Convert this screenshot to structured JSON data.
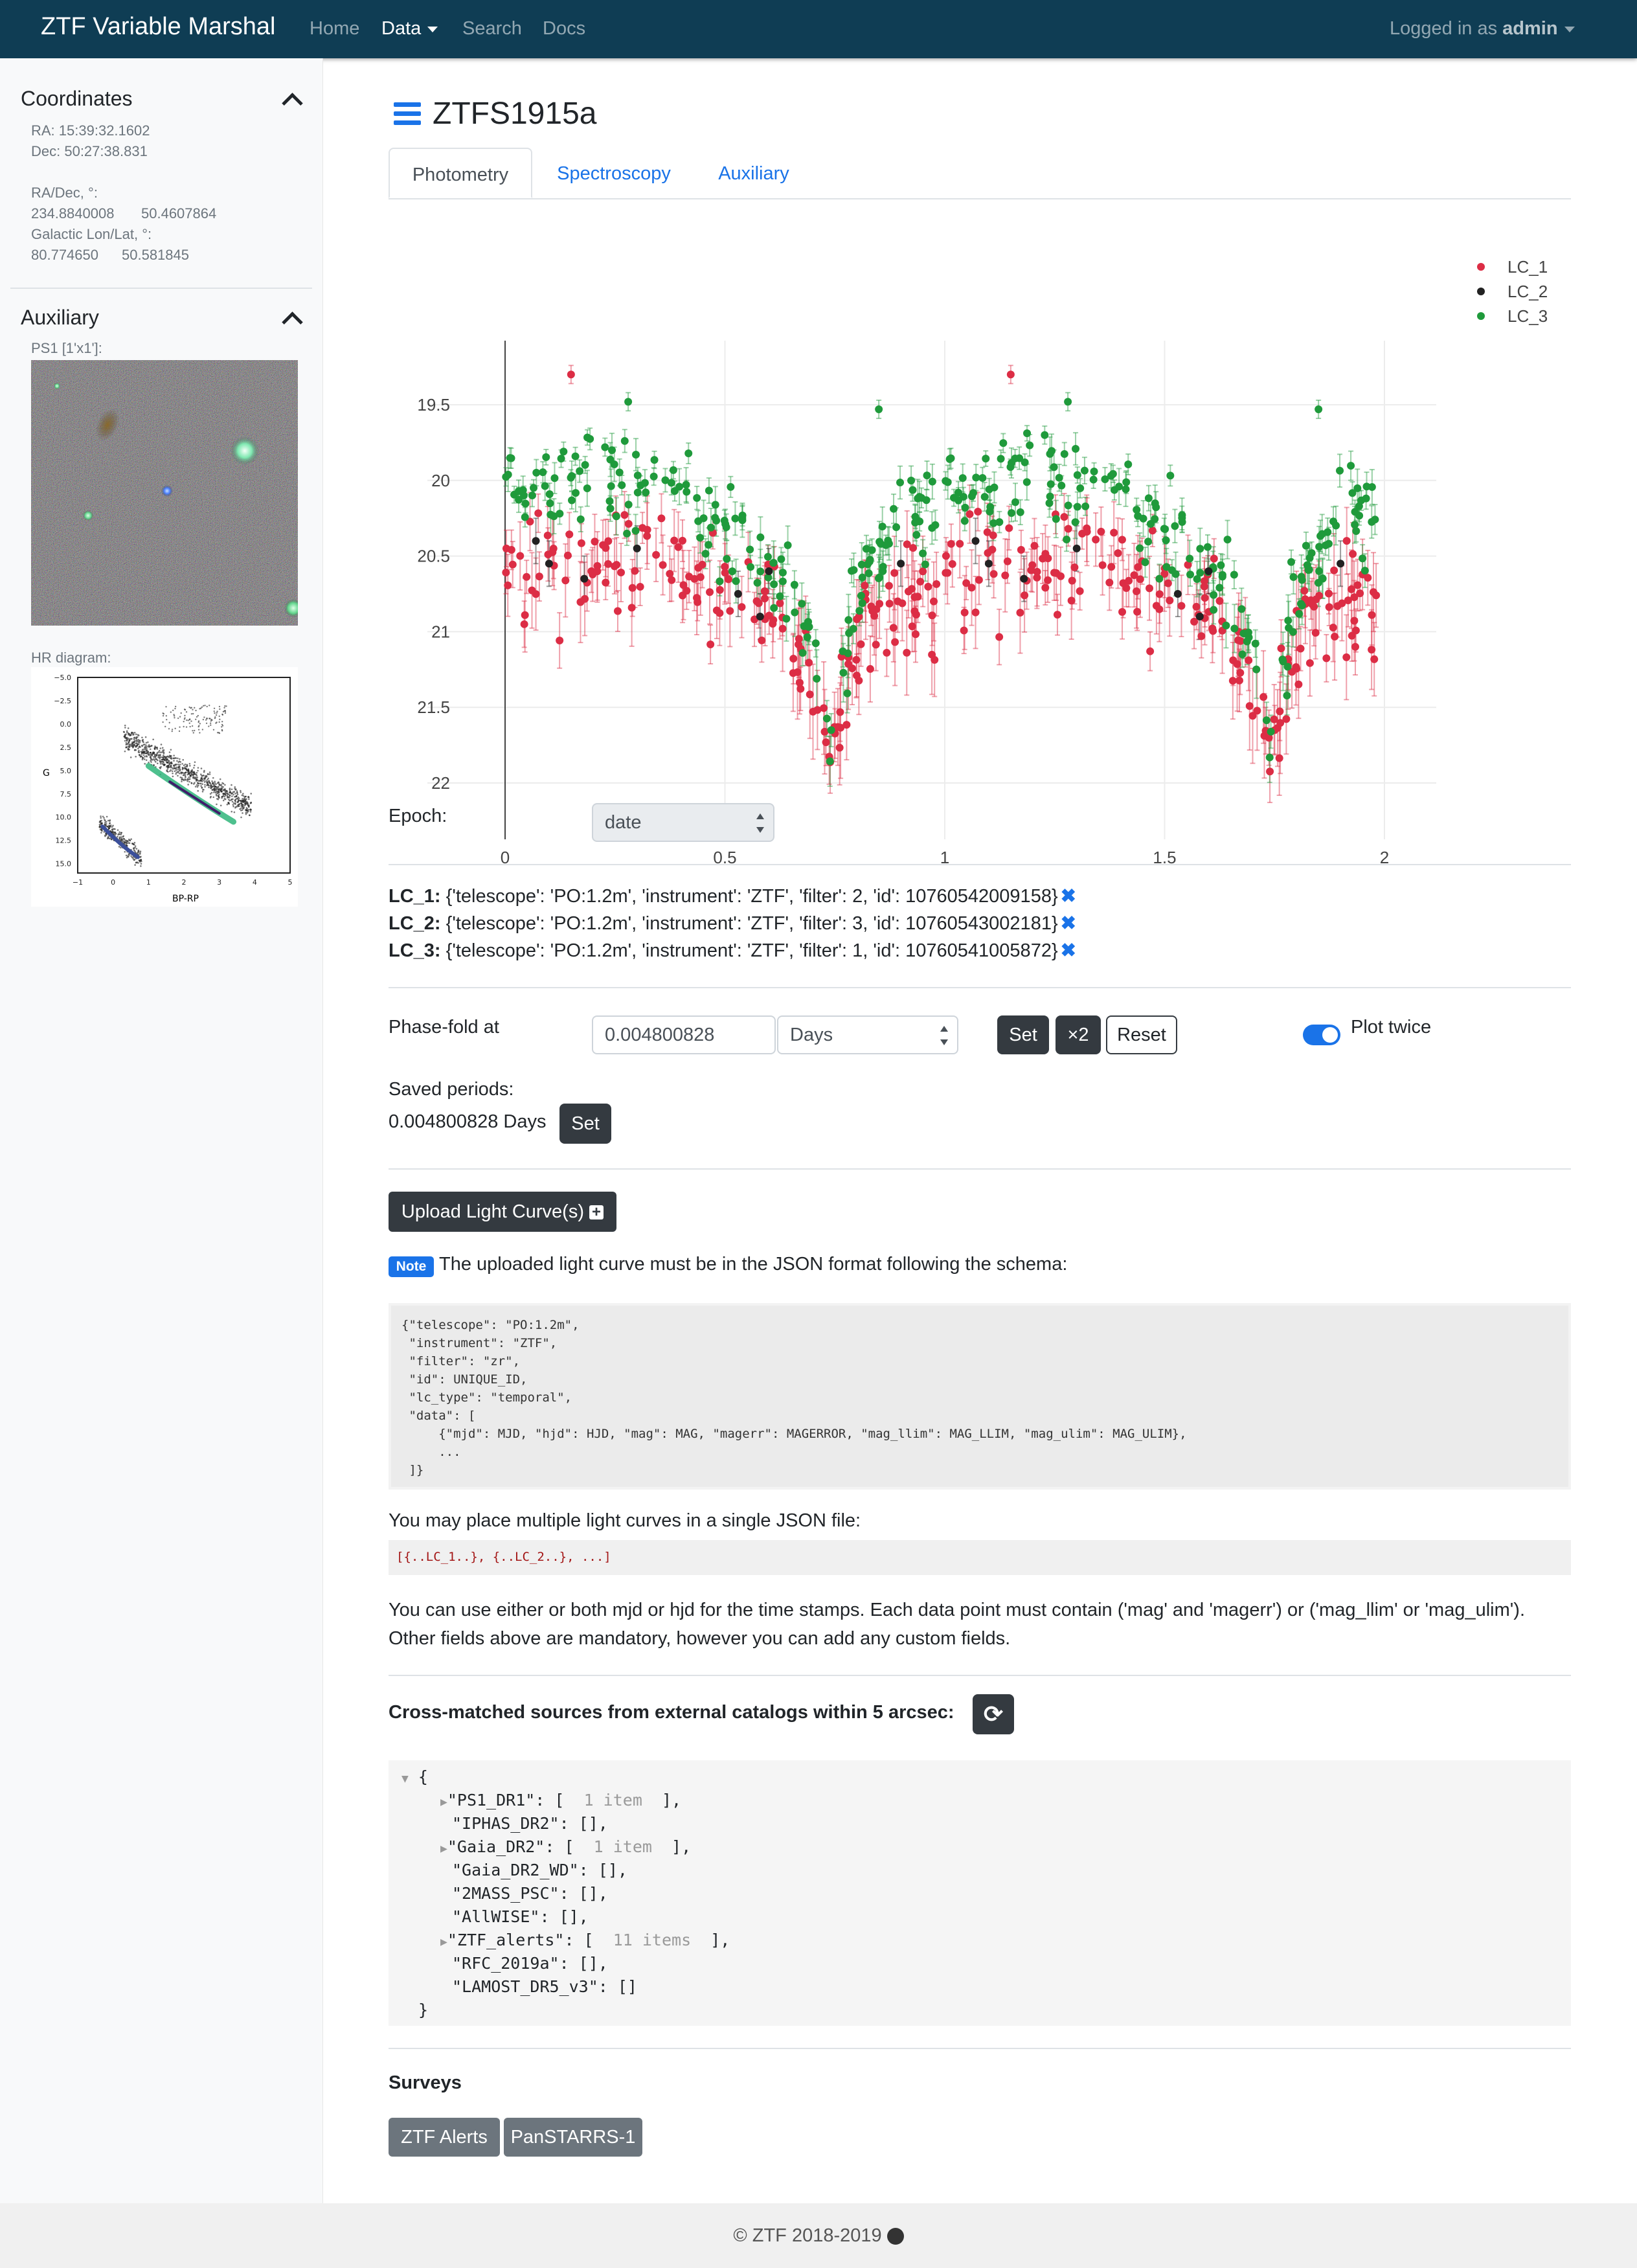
{
  "navbar": {
    "brand": "ZTF Variable Marshal",
    "links": [
      "Home",
      "Data",
      "Search",
      "Docs"
    ],
    "user_prefix": "Logged in as",
    "user_name": "admin"
  },
  "sidebar": {
    "coordinates": {
      "title": "Coordinates",
      "ra": "RA: 15:39:32.1602",
      "dec": "Dec: 50:27:38.831",
      "radec_label": "RA/Dec, °:",
      "ra_deg": "234.8840008",
      "dec_deg": "50.4607864",
      "gal_label": "Galactic Lon/Lat, °:",
      "gal_lon": "80.774650",
      "gal_lat": "50.581845"
    },
    "auxiliary": {
      "title": "Auxiliary",
      "ps1_label": "PS1 [1'x1']:",
      "hr_label": "HR diagram:",
      "hr_ylabel": "G",
      "hr_xlabel": "BP-RP",
      "hr_yticks": [
        "−5.0",
        "−2.5",
        "0.0",
        "2.5",
        "5.0",
        "7.5",
        "10.0",
        "12.5",
        "15.0"
      ],
      "hr_xticks": [
        "−1",
        "0",
        "1",
        "2",
        "3",
        "4",
        "5"
      ]
    }
  },
  "main": {
    "title": "ZTFS1915a",
    "tabs": [
      "Photometry",
      "Spectroscopy",
      "Auxiliary"
    ],
    "epoch_label": "Epoch:",
    "epoch_value": "date",
    "lc_lines": [
      {
        "name": "LC_1:",
        "desc": "{'telescope': 'PO:1.2m', 'instrument': 'ZTF', 'filter': 2, 'id': 10760542009158}"
      },
      {
        "name": "LC_2:",
        "desc": "{'telescope': 'PO:1.2m', 'instrument': 'ZTF', 'filter': 3, 'id': 10760543002181}"
      },
      {
        "name": "LC_3:",
        "desc": "{'telescope': 'PO:1.2m', 'instrument': 'ZTF', 'filter': 1, 'id': 10760541005872}"
      }
    ],
    "phasefold_label": "Phase-fold at",
    "phasefold_value": "0.004800828",
    "units_value": "Days",
    "set_label": "Set",
    "x2_label": "×2",
    "reset_label": "Reset",
    "plot_twice_label": "Plot twice",
    "saved_periods_label": "Saved periods:",
    "saved_period_value": "0.004800828 Days",
    "saved_set_label": "Set",
    "upload_label": "Upload Light Curve(s)",
    "note_badge": "Note",
    "note_text": "The uploaded light curve must be in the JSON format following the schema:",
    "schema_lines": [
      "{\"telescope\": \"PO:1.2m\",",
      " \"instrument\": \"ZTF\",",
      " \"filter\": \"zr\",",
      " \"id\": UNIQUE_ID,",
      " \"lc_type\": \"temporal\",",
      " \"data\": [",
      "     {\"mjd\": MJD, \"hjd\": HJD, \"mag\": MAG, \"magerr\": MAGERROR, \"mag_llim\": MAG_LLIM, \"mag_ulim\": MAG_ULIM},",
      "     ...",
      " ]}"
    ],
    "multi_label": "You may place multiple light curves in a single JSON file:",
    "multi_code": "[{..LC_1..}, {..LC_2..}, ...]",
    "info_line1": "You can use either or both mjd or hjd for the time stamps. Each data point must contain ('mag' and 'magerr') or ('mag_llim' or 'mag_ulim').",
    "info_line2": "Other fields above are mandatory, however you can add any custom fields.",
    "xmatch_label": "Cross-matched sources from external catalogs within 5 arcsec:",
    "xmatch_json": [
      {
        "key": "\"PS1_DR1\": [",
        "count": "1 item",
        "end": " ],",
        "expandable": true
      },
      {
        "key": "\"IPHAS_DR2\": [],",
        "count": "",
        "end": "",
        "expandable": false
      },
      {
        "key": "\"Gaia_DR2\": [",
        "count": "1 item",
        "end": " ],",
        "expandable": true
      },
      {
        "key": "\"Gaia_DR2_WD\": [],",
        "count": "",
        "end": "",
        "expandable": false
      },
      {
        "key": "\"2MASS_PSC\": [],",
        "count": "",
        "end": "",
        "expandable": false
      },
      {
        "key": "\"AllWISE\": [],",
        "count": "",
        "end": "",
        "expandable": false
      },
      {
        "key": "\"ZTF_alerts\": [",
        "count": "11 items",
        "end": " ],",
        "expandable": true
      },
      {
        "key": "\"RFC_2019a\": [],",
        "count": "",
        "end": "",
        "expandable": false
      },
      {
        "key": "\"LAMOST_DR5_v3\": []",
        "count": "",
        "end": "",
        "expandable": false
      }
    ],
    "surveys_label": "Surveys",
    "survey_buttons": [
      "ZTF Alerts",
      "PanSTARRS-1"
    ]
  },
  "footer": {
    "text": "© ZTF 2018-2019"
  },
  "colors": {
    "navbar": "#0f3d54",
    "lc1": "#dc2d45",
    "lc2": "#222222",
    "lc3": "#1f9a3b",
    "link": "#1a73e8"
  },
  "chart_data": {
    "type": "scatter",
    "title": "",
    "xlabel": "",
    "ylabel": "",
    "xlim": [
      -0.1,
      2.1
    ],
    "ylim": [
      22.3,
      19.1
    ],
    "x_ticks": [
      "0",
      "0.5",
      "1",
      "1.5",
      "2"
    ],
    "y_ticks": [
      "19.5",
      "20",
      "20.5",
      "21",
      "21.5",
      "22"
    ],
    "y_inverted": true,
    "legend_position": "top-right",
    "series": [
      {
        "name": "LC_1",
        "color": "#dc2d45",
        "description": "phase-folded light curve, plotted twice (phase 0-2)",
        "profile": [
          [
            0,
            20.75
          ],
          [
            0.2,
            20.5
          ],
          [
            0.4,
            20.55
          ],
          [
            0.55,
            20.8
          ],
          [
            0.68,
            21.15
          ],
          [
            0.74,
            21.9
          ],
          [
            0.8,
            21.1
          ],
          [
            0.9,
            20.85
          ],
          [
            1.0,
            20.75
          ]
        ],
        "n_per_cycle": 170,
        "spread": 0.18,
        "err": 0.16
      },
      {
        "name": "LC_2",
        "color": "#222222",
        "description": "sparse points",
        "points": [
          [
            0.07,
            20.4
          ],
          [
            0.1,
            20.55
          ],
          [
            0.18,
            20.65
          ],
          [
            0.3,
            20.45
          ],
          [
            0.53,
            20.75
          ],
          [
            0.58,
            20.9
          ],
          [
            0.6,
            20.6
          ],
          [
            0.9,
            20.55
          ],
          [
            1.07,
            20.4
          ],
          [
            1.1,
            20.55
          ],
          [
            1.18,
            20.65
          ],
          [
            1.3,
            20.45
          ],
          [
            1.53,
            20.75
          ],
          [
            1.58,
            20.9
          ],
          [
            1.6,
            20.6
          ],
          [
            1.9,
            20.55
          ]
        ]
      },
      {
        "name": "LC_3",
        "color": "#1f9a3b",
        "description": "phase-folded light curve, plotted twice (phase 0-2)",
        "profile": [
          [
            0,
            20.1
          ],
          [
            0.2,
            19.95
          ],
          [
            0.4,
            20.05
          ],
          [
            0.55,
            20.4
          ],
          [
            0.68,
            20.9
          ],
          [
            0.74,
            21.6
          ],
          [
            0.8,
            20.7
          ],
          [
            0.9,
            20.3
          ],
          [
            1.0,
            20.1
          ]
        ],
        "n_per_cycle": 170,
        "spread": 0.17,
        "err": 0.1
      }
    ],
    "outliers": [
      {
        "series": "LC_1",
        "x": 0.15,
        "y": 19.3
      },
      {
        "series": "LC_1",
        "x": 1.15,
        "y": 19.3
      },
      {
        "series": "LC_3",
        "x": 0.28,
        "y": 19.48
      },
      {
        "series": "LC_3",
        "x": 0.85,
        "y": 19.53
      },
      {
        "series": "LC_3",
        "x": 1.28,
        "y": 19.48
      },
      {
        "series": "LC_3",
        "x": 1.85,
        "y": 19.53
      }
    ]
  }
}
